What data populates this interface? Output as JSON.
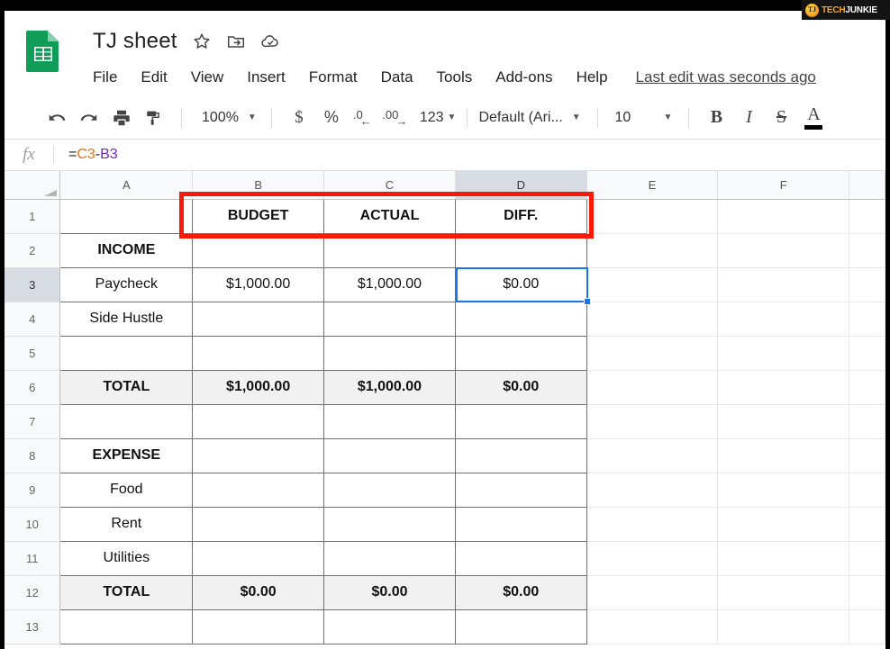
{
  "watermark": {
    "logo_text": "TJ",
    "tech": "TECH",
    "junkie": "JUNKIE"
  },
  "header": {
    "app_icon": "google-sheets-icon",
    "doc_title": "TJ sheet",
    "icons": [
      {
        "name": "star-icon",
        "label": "Star"
      },
      {
        "name": "move-to-folder-icon",
        "label": "Move"
      },
      {
        "name": "cloud-saved-icon",
        "label": "Saved to Drive"
      }
    ],
    "menu": [
      "File",
      "Edit",
      "View",
      "Insert",
      "Format",
      "Data",
      "Tools",
      "Add-ons",
      "Help"
    ],
    "last_edit": "Last edit was seconds ago"
  },
  "toolbar": {
    "undo": "undo-icon",
    "redo": "redo-icon",
    "print": "print-icon",
    "paint_format": "paint-format-icon",
    "zoom_value": "100%",
    "currency": "$",
    "percent": "%",
    "decrease_decimal": ".0",
    "increase_decimal": ".00",
    "number_format": "123",
    "font_name": "Default (Ari...",
    "font_size": "10",
    "bold": "B",
    "italic": "I",
    "strikethrough": "S",
    "text_color": "A"
  },
  "formula_bar": {
    "fx_label": "fx",
    "formula_prefix": "=",
    "ref1": "C3",
    "operator": "-",
    "ref2": "B3"
  },
  "grid": {
    "columns": [
      "A",
      "B",
      "C",
      "D",
      "E",
      "F"
    ],
    "active_column": "D",
    "active_row": 3,
    "selected_cell": "D3",
    "rows": [
      {
        "num": "1",
        "cells": [
          "",
          "BUDGET",
          "ACTUAL",
          "DIFF.",
          "",
          ""
        ],
        "style": "header-row"
      },
      {
        "num": "2",
        "cells": [
          "INCOME",
          "",
          "",
          "",
          "",
          ""
        ],
        "style": "bold"
      },
      {
        "num": "3",
        "cells": [
          "Paycheck",
          "$1,000.00",
          "$1,000.00",
          "$0.00",
          "",
          ""
        ],
        "style": "normal"
      },
      {
        "num": "4",
        "cells": [
          "Side Hustle",
          "",
          "",
          "",
          "",
          ""
        ],
        "style": "normal"
      },
      {
        "num": "5",
        "cells": [
          "",
          "",
          "",
          "",
          "",
          ""
        ],
        "style": "normal"
      },
      {
        "num": "6",
        "cells": [
          "TOTAL",
          "$1,000.00",
          "$1,000.00",
          "$0.00",
          "",
          ""
        ],
        "style": "total"
      },
      {
        "num": "7",
        "cells": [
          "",
          "",
          "",
          "",
          "",
          ""
        ],
        "style": "normal"
      },
      {
        "num": "8",
        "cells": [
          "EXPENSE",
          "",
          "",
          "",
          "",
          ""
        ],
        "style": "bold"
      },
      {
        "num": "9",
        "cells": [
          "Food",
          "",
          "",
          "",
          "",
          ""
        ],
        "style": "normal"
      },
      {
        "num": "10",
        "cells": [
          "Rent",
          "",
          "",
          "",
          "",
          ""
        ],
        "style": "normal"
      },
      {
        "num": "11",
        "cells": [
          "Utilities",
          "",
          "",
          "",
          "",
          ""
        ],
        "style": "normal"
      },
      {
        "num": "12",
        "cells": [
          "TOTAL",
          "$0.00",
          "$0.00",
          "$0.00",
          "",
          ""
        ],
        "style": "total"
      },
      {
        "num": "13",
        "cells": [
          "",
          "",
          "",
          "",
          "",
          ""
        ],
        "style": "normal"
      }
    ]
  },
  "annotation": {
    "color": "#f81a08",
    "target_range": "B1:D1"
  }
}
